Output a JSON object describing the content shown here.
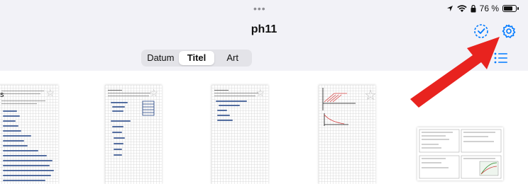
{
  "status": {
    "dots": "•••",
    "battery_percent": 76,
    "battery_text": "76 %"
  },
  "header": {
    "title": "ph11",
    "icons": [
      "checkmark-circle-icon",
      "gear-icon"
    ]
  },
  "sort": {
    "options": [
      "Datum",
      "Titel",
      "Art"
    ],
    "selected": "Titel"
  },
  "side_char": "s",
  "documents": [
    {
      "kind": "handwritten-notes"
    },
    {
      "kind": "handwritten-calculation"
    },
    {
      "kind": "handwritten-short"
    },
    {
      "kind": "graph-sketch"
    },
    {
      "kind": "worksheet"
    }
  ],
  "colors": {
    "accent": "#007aff",
    "arrow": "#e8231f",
    "toolbar_bg": "#f2f2f7"
  }
}
